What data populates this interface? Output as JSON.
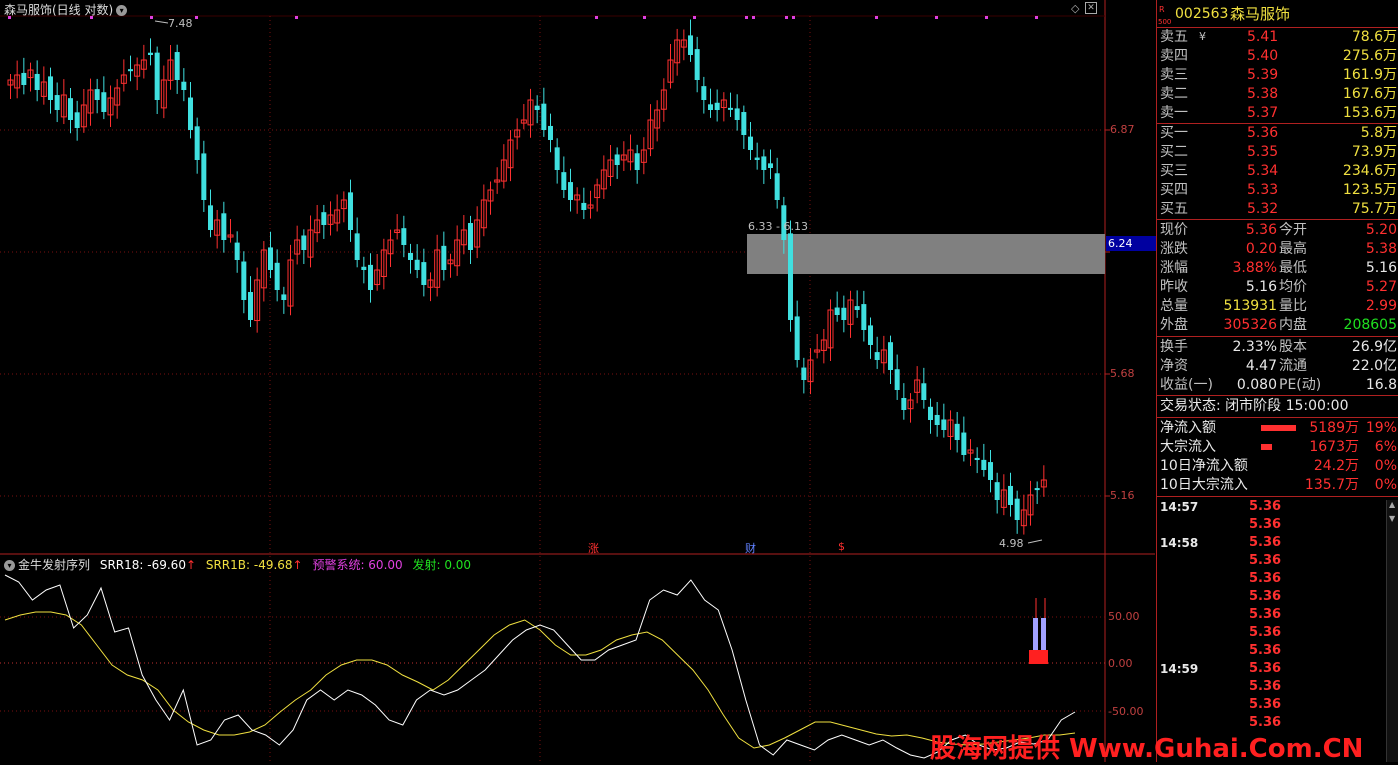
{
  "header": {
    "title": "森马服饰(日线 对数)",
    "high_marker": "7.48",
    "low_marker": "4.98",
    "range_label": "6.33 - 6.13",
    "badges": [
      "涨",
      "财",
      "$"
    ]
  },
  "price_axis": [
    "6.87",
    "6.24",
    "5.68",
    "5.16"
  ],
  "current_price_tag": "6.24",
  "indicator": {
    "name": "金牛发射序列",
    "srr18_label": "SRR18: -69.60",
    "srr1b_label": "SRR1B: -49.68",
    "warn_label": "预警系统: 60.00",
    "fire_label": "发射: 0.00",
    "axis": [
      "50.00",
      "0.00",
      "-50.00"
    ],
    "colors": {
      "srr18": "#ffffff",
      "srr1b": "#f0e040",
      "warn": "#e040e0",
      "fire": "#20e020"
    }
  },
  "quote": {
    "code": "002563",
    "name": "森马服饰",
    "tag_r": "R",
    "tag_500": "500",
    "asks": [
      {
        "label": "卖五",
        "price": "5.41",
        "vol": "78.6万"
      },
      {
        "label": "卖四",
        "price": "5.40",
        "vol": "275.6万"
      },
      {
        "label": "卖三",
        "price": "5.39",
        "vol": "161.9万"
      },
      {
        "label": "卖二",
        "price": "5.38",
        "vol": "167.6万"
      },
      {
        "label": "卖一",
        "price": "5.37",
        "vol": "153.6万"
      }
    ],
    "bids": [
      {
        "label": "买一",
        "price": "5.36",
        "vol": "5.8万"
      },
      {
        "label": "买二",
        "price": "5.35",
        "vol": "73.9万"
      },
      {
        "label": "买三",
        "price": "5.34",
        "vol": "234.6万"
      },
      {
        "label": "买四",
        "price": "5.33",
        "vol": "123.5万"
      },
      {
        "label": "买五",
        "price": "5.32",
        "vol": "75.7万"
      }
    ],
    "stats": [
      {
        "l1": "现价",
        "v1": "5.36",
        "c1": "red",
        "l2": "今开",
        "v2": "5.20",
        "c2": "red"
      },
      {
        "l1": "涨跌",
        "v1": "0.20",
        "c1": "red",
        "l2": "最高",
        "v2": "5.38",
        "c2": "red"
      },
      {
        "l1": "涨幅",
        "v1": "3.88%",
        "c1": "red",
        "l2": "最低",
        "v2": "5.16",
        "c2": "white"
      },
      {
        "l1": "昨收",
        "v1": "5.16",
        "c1": "white",
        "l2": "均价",
        "v2": "5.27",
        "c2": "red"
      },
      {
        "l1": "总量",
        "v1": "513931",
        "c1": "yellow",
        "l2": "量比",
        "v2": "2.99",
        "c2": "red"
      },
      {
        "l1": "外盘",
        "v1": "305326",
        "c1": "red",
        "l2": "内盘",
        "v2": "208605",
        "c2": "green"
      }
    ],
    "stats2": [
      {
        "l1": "换手",
        "v1": "2.33%",
        "l2": "股本",
        "v2": "26.9亿"
      },
      {
        "l1": "净资",
        "v1": "4.47",
        "l2": "流通",
        "v2": "22.0亿"
      },
      {
        "l1": "收益(一)",
        "v1": "0.080",
        "l2": "PE(动)",
        "v2": "16.8"
      }
    ],
    "trade_status": "交易状态: 闭市阶段 15:00:00",
    "flows": [
      {
        "label": "净流入额",
        "value": "5189万",
        "pct": "19%",
        "bar": 0.7
      },
      {
        "label": "大宗流入",
        "value": "1673万",
        "pct": "6%",
        "bar": 0.22
      },
      {
        "label": "10日净流入额",
        "value": "24.2万",
        "pct": "0%",
        "bar": 0
      },
      {
        "label": "10日大宗流入",
        "value": "135.7万",
        "pct": "0%",
        "bar": 0
      }
    ],
    "ticks": [
      {
        "time": "14:57",
        "price": "5.36"
      },
      {
        "time": "",
        "price": "5.36"
      },
      {
        "time": "14:58",
        "price": "5.36"
      },
      {
        "time": "",
        "price": "5.36"
      },
      {
        "time": "",
        "price": "5.36"
      },
      {
        "time": "",
        "price": "5.36"
      },
      {
        "time": "",
        "price": "5.36"
      },
      {
        "time": "",
        "price": "5.36"
      },
      {
        "time": "",
        "price": "5.36"
      },
      {
        "time": "14:59",
        "price": "5.36"
      },
      {
        "time": "",
        "price": "5.36"
      },
      {
        "time": "",
        "price": "5.36"
      },
      {
        "time": "",
        "price": "5.36"
      }
    ]
  },
  "watermark": "股海网提供 Www.Guhai.Com.CN"
}
